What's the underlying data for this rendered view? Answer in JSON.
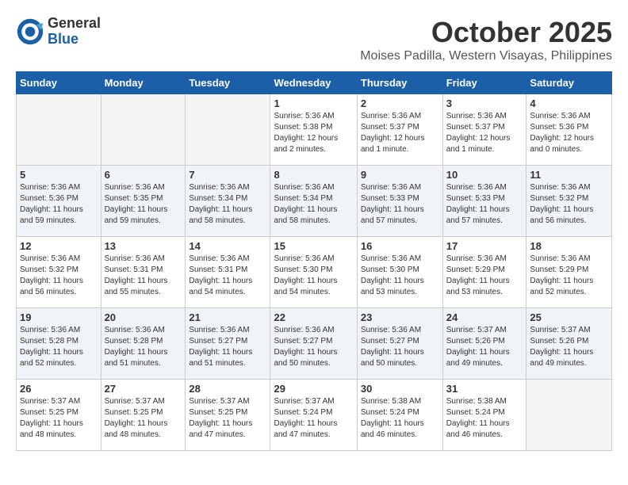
{
  "header": {
    "logo_general": "General",
    "logo_blue": "Blue",
    "month_title": "October 2025",
    "location": "Moises Padilla, Western Visayas, Philippines"
  },
  "days_of_week": [
    "Sunday",
    "Monday",
    "Tuesday",
    "Wednesday",
    "Thursday",
    "Friday",
    "Saturday"
  ],
  "weeks": [
    [
      {
        "day": "",
        "info": ""
      },
      {
        "day": "",
        "info": ""
      },
      {
        "day": "",
        "info": ""
      },
      {
        "day": "1",
        "info": "Sunrise: 5:36 AM\nSunset: 5:38 PM\nDaylight: 12 hours\nand 2 minutes."
      },
      {
        "day": "2",
        "info": "Sunrise: 5:36 AM\nSunset: 5:37 PM\nDaylight: 12 hours\nand 1 minute."
      },
      {
        "day": "3",
        "info": "Sunrise: 5:36 AM\nSunset: 5:37 PM\nDaylight: 12 hours\nand 1 minute."
      },
      {
        "day": "4",
        "info": "Sunrise: 5:36 AM\nSunset: 5:36 PM\nDaylight: 12 hours\nand 0 minutes."
      }
    ],
    [
      {
        "day": "5",
        "info": "Sunrise: 5:36 AM\nSunset: 5:36 PM\nDaylight: 11 hours\nand 59 minutes."
      },
      {
        "day": "6",
        "info": "Sunrise: 5:36 AM\nSunset: 5:35 PM\nDaylight: 11 hours\nand 59 minutes."
      },
      {
        "day": "7",
        "info": "Sunrise: 5:36 AM\nSunset: 5:34 PM\nDaylight: 11 hours\nand 58 minutes."
      },
      {
        "day": "8",
        "info": "Sunrise: 5:36 AM\nSunset: 5:34 PM\nDaylight: 11 hours\nand 58 minutes."
      },
      {
        "day": "9",
        "info": "Sunrise: 5:36 AM\nSunset: 5:33 PM\nDaylight: 11 hours\nand 57 minutes."
      },
      {
        "day": "10",
        "info": "Sunrise: 5:36 AM\nSunset: 5:33 PM\nDaylight: 11 hours\nand 57 minutes."
      },
      {
        "day": "11",
        "info": "Sunrise: 5:36 AM\nSunset: 5:32 PM\nDaylight: 11 hours\nand 56 minutes."
      }
    ],
    [
      {
        "day": "12",
        "info": "Sunrise: 5:36 AM\nSunset: 5:32 PM\nDaylight: 11 hours\nand 56 minutes."
      },
      {
        "day": "13",
        "info": "Sunrise: 5:36 AM\nSunset: 5:31 PM\nDaylight: 11 hours\nand 55 minutes."
      },
      {
        "day": "14",
        "info": "Sunrise: 5:36 AM\nSunset: 5:31 PM\nDaylight: 11 hours\nand 54 minutes."
      },
      {
        "day": "15",
        "info": "Sunrise: 5:36 AM\nSunset: 5:30 PM\nDaylight: 11 hours\nand 54 minutes."
      },
      {
        "day": "16",
        "info": "Sunrise: 5:36 AM\nSunset: 5:30 PM\nDaylight: 11 hours\nand 53 minutes."
      },
      {
        "day": "17",
        "info": "Sunrise: 5:36 AM\nSunset: 5:29 PM\nDaylight: 11 hours\nand 53 minutes."
      },
      {
        "day": "18",
        "info": "Sunrise: 5:36 AM\nSunset: 5:29 PM\nDaylight: 11 hours\nand 52 minutes."
      }
    ],
    [
      {
        "day": "19",
        "info": "Sunrise: 5:36 AM\nSunset: 5:28 PM\nDaylight: 11 hours\nand 52 minutes."
      },
      {
        "day": "20",
        "info": "Sunrise: 5:36 AM\nSunset: 5:28 PM\nDaylight: 11 hours\nand 51 minutes."
      },
      {
        "day": "21",
        "info": "Sunrise: 5:36 AM\nSunset: 5:27 PM\nDaylight: 11 hours\nand 51 minutes."
      },
      {
        "day": "22",
        "info": "Sunrise: 5:36 AM\nSunset: 5:27 PM\nDaylight: 11 hours\nand 50 minutes."
      },
      {
        "day": "23",
        "info": "Sunrise: 5:36 AM\nSunset: 5:27 PM\nDaylight: 11 hours\nand 50 minutes."
      },
      {
        "day": "24",
        "info": "Sunrise: 5:37 AM\nSunset: 5:26 PM\nDaylight: 11 hours\nand 49 minutes."
      },
      {
        "day": "25",
        "info": "Sunrise: 5:37 AM\nSunset: 5:26 PM\nDaylight: 11 hours\nand 49 minutes."
      }
    ],
    [
      {
        "day": "26",
        "info": "Sunrise: 5:37 AM\nSunset: 5:25 PM\nDaylight: 11 hours\nand 48 minutes."
      },
      {
        "day": "27",
        "info": "Sunrise: 5:37 AM\nSunset: 5:25 PM\nDaylight: 11 hours\nand 48 minutes."
      },
      {
        "day": "28",
        "info": "Sunrise: 5:37 AM\nSunset: 5:25 PM\nDaylight: 11 hours\nand 47 minutes."
      },
      {
        "day": "29",
        "info": "Sunrise: 5:37 AM\nSunset: 5:24 PM\nDaylight: 11 hours\nand 47 minutes."
      },
      {
        "day": "30",
        "info": "Sunrise: 5:38 AM\nSunset: 5:24 PM\nDaylight: 11 hours\nand 46 minutes."
      },
      {
        "day": "31",
        "info": "Sunrise: 5:38 AM\nSunset: 5:24 PM\nDaylight: 11 hours\nand 46 minutes."
      },
      {
        "day": "",
        "info": ""
      }
    ]
  ]
}
